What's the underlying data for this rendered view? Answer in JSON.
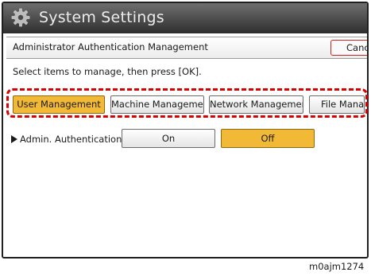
{
  "window": {
    "title": "System Settings"
  },
  "header": {
    "title": "Administrator Authentication Management",
    "cancel_label": "Cancel"
  },
  "instruction": "Select items to manage, then press [OK].",
  "tabs": [
    {
      "label": "User Management",
      "selected": true
    },
    {
      "label": "Machine Management",
      "selected": false
    },
    {
      "label": "Network Management",
      "selected": false
    },
    {
      "label": "File Management",
      "selected": false
    }
  ],
  "admin_auth": {
    "label": "Admin. Authentication",
    "options": [
      {
        "label": "On",
        "selected": false
      },
      {
        "label": "Off",
        "selected": true
      }
    ]
  },
  "caption": "m0ajm1274",
  "colors": {
    "selected": "#f2b936",
    "highlight": "#d80000",
    "titlebar": "#3a3a3a"
  },
  "icons": {
    "title_icon": "gear-icon",
    "admin_arrow": "triangle-right-icon"
  }
}
